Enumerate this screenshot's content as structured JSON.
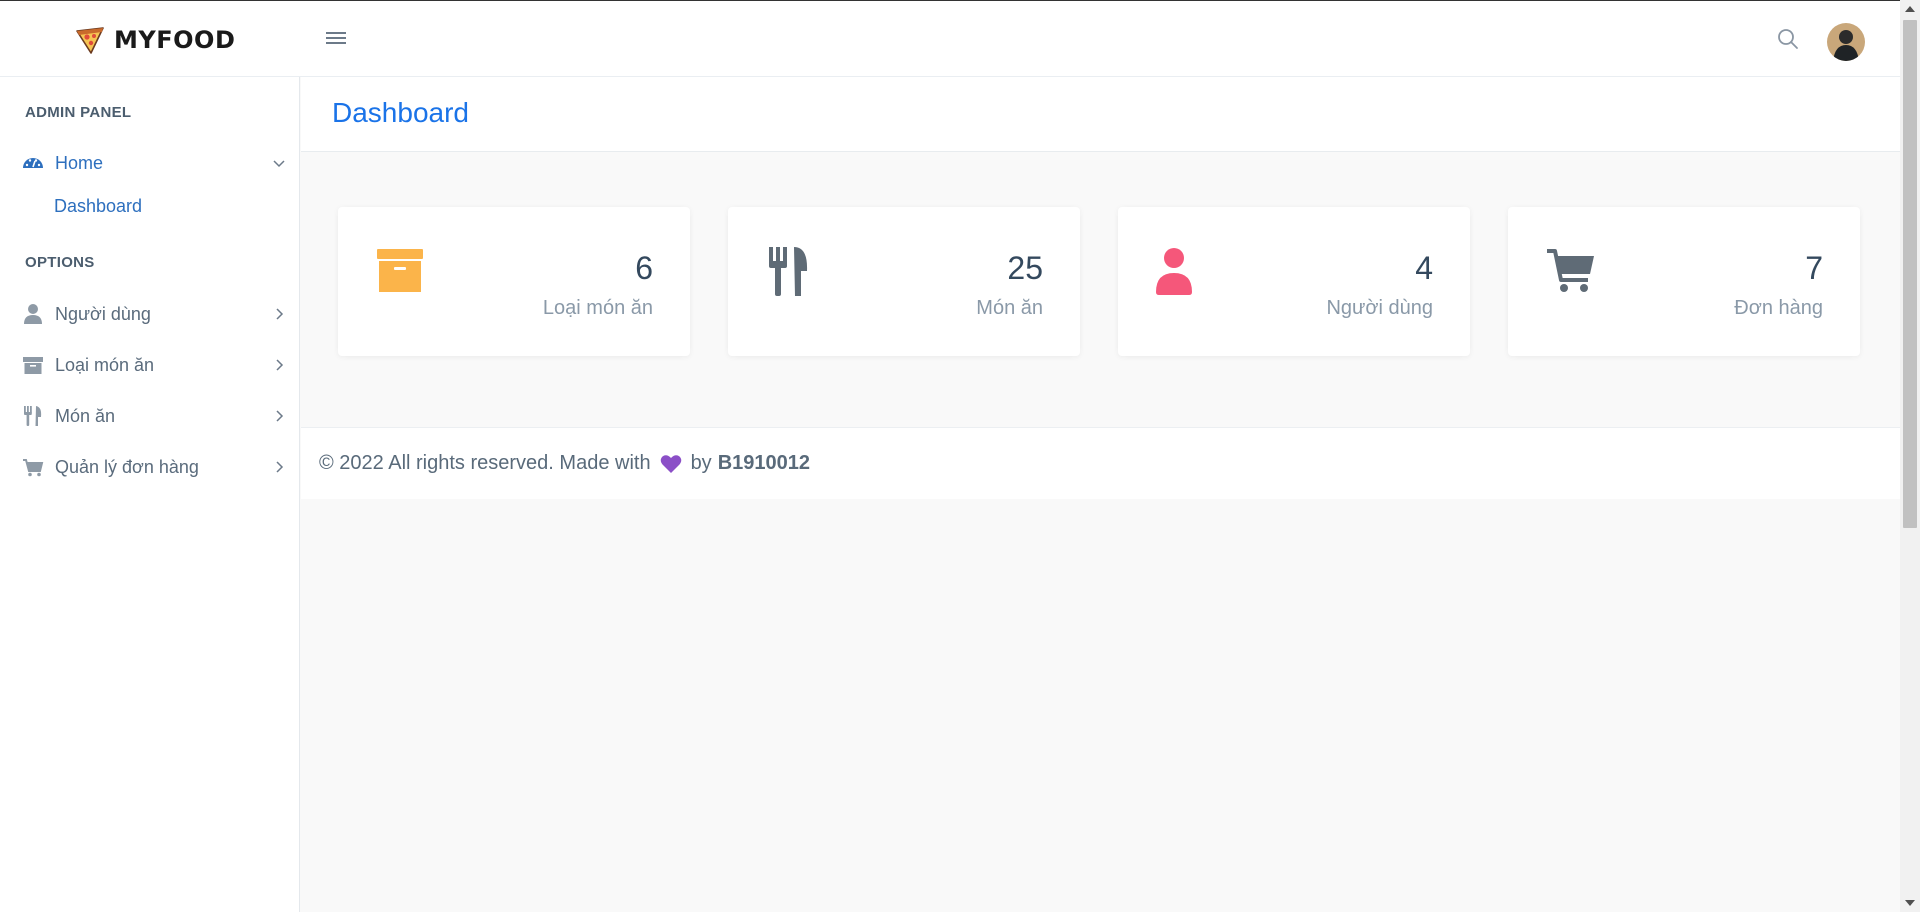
{
  "brand": {
    "name": "MYFOOD",
    "logo_icon": "pizza-icon"
  },
  "header": {
    "menu_icon": "hamburger-icon",
    "search_icon": "search-icon",
    "avatar_icon": "user-avatar"
  },
  "sidebar": {
    "admin_title": "ADMIN PANEL",
    "home": {
      "label": "Home",
      "icon": "dashboard-gauge-icon",
      "expanded": true
    },
    "home_sub": {
      "label": "Dashboard"
    },
    "options_title": "OPTIONS",
    "items": [
      {
        "label": "Người dùng",
        "icon": "user-icon"
      },
      {
        "label": "Loại món ăn",
        "icon": "archive-box-icon"
      },
      {
        "label": "Món ăn",
        "icon": "utensils-icon"
      },
      {
        "label": "Quản lý đơn hàng",
        "icon": "cart-icon"
      }
    ]
  },
  "page": {
    "title": "Dashboard"
  },
  "cards": [
    {
      "value": "6",
      "label": "Loại món ăn",
      "icon": "archive-box-icon",
      "color": "#fbb44a"
    },
    {
      "value": "25",
      "label": "Món ăn",
      "icon": "utensils-icon",
      "color": "#5f6b76"
    },
    {
      "value": "4",
      "label": "Người dùng",
      "icon": "user-icon",
      "color": "#f5577a"
    },
    {
      "value": "7",
      "label": "Đơn hàng",
      "icon": "cart-icon",
      "color": "#5f6b76"
    }
  ],
  "footer": {
    "text": "© 2022 All rights reserved. Made with",
    "by": "by",
    "author": "B1910012",
    "heart_icon": "purple-heart-icon"
  },
  "colors": {
    "accent": "#2d6fbe",
    "title_blue": "#1a73e8"
  }
}
